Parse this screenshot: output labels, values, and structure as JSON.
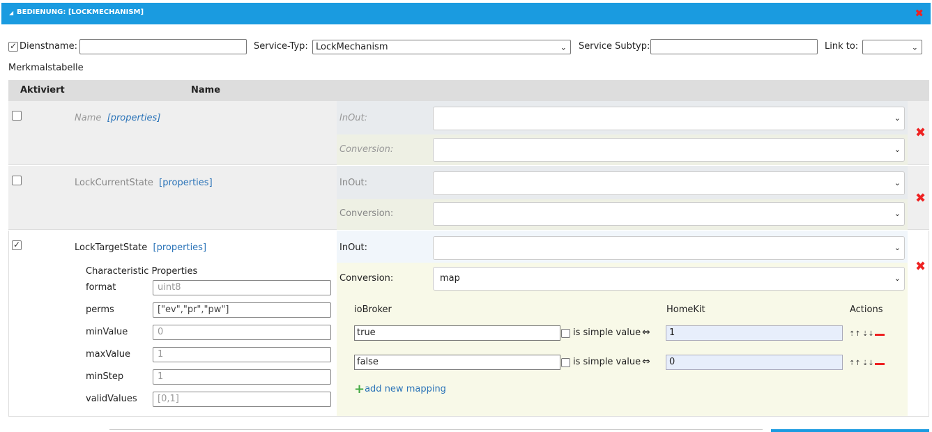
{
  "title": "BEDIENUNG: [LOCKMECHANISM]",
  "colors": {
    "accent": "#1a9be0",
    "danger": "#e22222",
    "link": "#2a73b8"
  },
  "top": {
    "dienstname_label": "Dienstname:",
    "dienstname_value": "",
    "servicetyp_label": "Service-Typ:",
    "servicetyp_value": "LockMechanism",
    "subtyp_label": "Service Subtyp:",
    "subtyp_value": "",
    "linkto_label": "Link to:",
    "linkto_value": ""
  },
  "merkmal_label": "Merkmalstabelle",
  "table_headers": {
    "aktiviert": "Aktiviert",
    "name": "Name"
  },
  "properties_link": "[properties]",
  "inout_label": "InOut:",
  "conversion_label": "Conversion:",
  "rows": [
    {
      "name": "Name",
      "checked": false,
      "inout": "",
      "conversion": ""
    },
    {
      "name": "LockCurrentState",
      "checked": false,
      "inout": "",
      "conversion": ""
    },
    {
      "name": "LockTargetState",
      "checked": true,
      "inout": "",
      "conversion": "map"
    }
  ],
  "char_props": {
    "title": "Characteristic Properties",
    "items": [
      {
        "label": "format",
        "value": "uint8"
      },
      {
        "label": "perms",
        "value": "[\"ev\",\"pr\",\"pw\"]"
      },
      {
        "label": "minValue",
        "value": "0"
      },
      {
        "label": "maxValue",
        "value": "1"
      },
      {
        "label": "minStep",
        "value": "1"
      },
      {
        "label": "validValues",
        "value": "[0,1]"
      }
    ]
  },
  "mapping": {
    "col_iobroker": "ioBroker",
    "col_homekit": "HomeKit",
    "col_actions": "Actions",
    "simple_label": "is simple value",
    "arrow": "⇔",
    "add_label": "add new mapping",
    "rows": [
      {
        "iobroker": "true",
        "homekit": "1"
      },
      {
        "iobroker": "false",
        "homekit": "0"
      }
    ]
  }
}
